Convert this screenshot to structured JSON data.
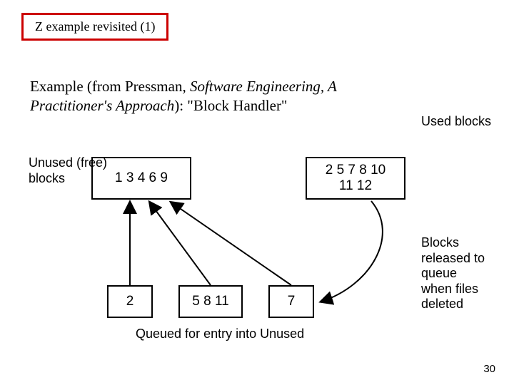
{
  "title": "Z example revisited (1)",
  "intro_plain1": "Example (from Pressman, ",
  "intro_italic1": "Software Engineering, A Practitioner's Approach",
  "intro_plain2": "): \"Block Handler\"",
  "labels": {
    "used": "Used blocks",
    "free": "Unused (free)\n blocks",
    "released": "Blocks released to queue when files deleted"
  },
  "boxes": {
    "unused": "1 3 4 6 9",
    "used": "2 5 7 8 10\n11 12",
    "q1": "2",
    "q2": "5 8 11",
    "q3": "7"
  },
  "queued_caption": "Queued for entry into Unused",
  "page_number": "30"
}
